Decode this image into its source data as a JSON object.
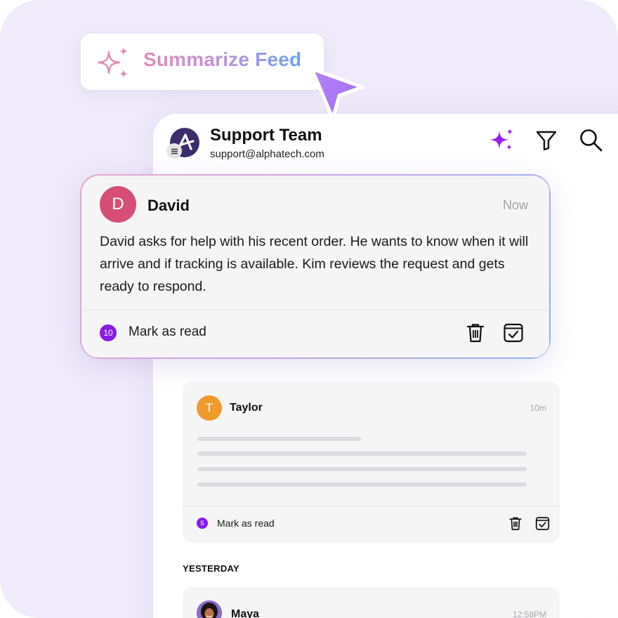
{
  "summarize": {
    "label": "Summarize Feed",
    "icon": "sparkle-icon"
  },
  "header": {
    "title": "Support Team",
    "email": "support@alphatech.com",
    "icons": [
      "ai-sparkle-icon",
      "filter-icon",
      "search-icon"
    ]
  },
  "featured": {
    "avatar_letter": "D",
    "name": "David",
    "time": "Now",
    "summary": "David asks for help with his recent order. He wants to know when it will arrive and if tracking is available. Kim reviews the request and gets ready to respond.",
    "badge_count": "10",
    "mark_read": "Mark as read",
    "avatar_color": "#d64e76"
  },
  "messages": [
    {
      "avatar_letter": "T",
      "name": "Taylor",
      "time": "10m",
      "badge_count": "5",
      "mark_read": "Mark as read",
      "avatar_color": "#f09a2e"
    }
  ],
  "sections": {
    "yesterday": "YESTERDAY"
  },
  "yesterday_messages": [
    {
      "name": "Maya",
      "time": "12:58PM"
    }
  ],
  "colors": {
    "accent": "#8a1be6",
    "background": "#efebfa"
  }
}
